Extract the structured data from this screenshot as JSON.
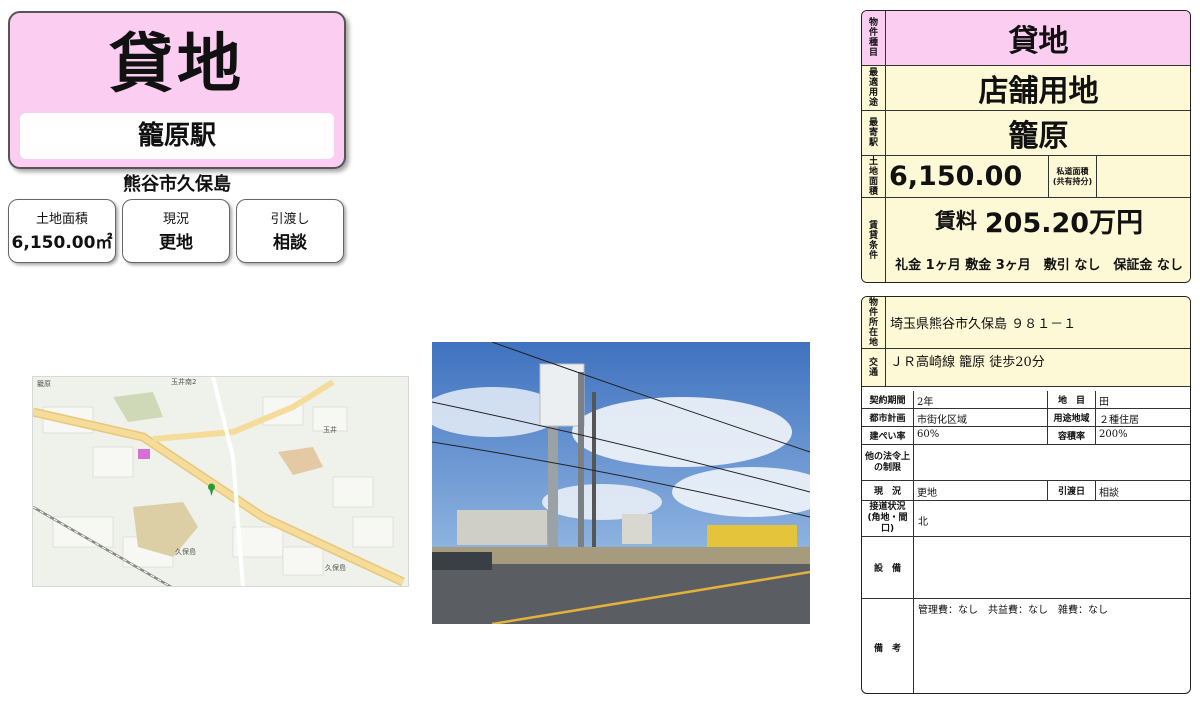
{
  "title": {
    "property_type": "貸地",
    "station": "籠原駅",
    "address": "熊谷市久保島"
  },
  "info_boxes": [
    {
      "label": "土地面積",
      "value": "6,150.00㎡"
    },
    {
      "label": "現況",
      "value": "更地"
    },
    {
      "label": "引渡し",
      "value": "相談"
    }
  ],
  "summary": {
    "type_label": "物件種目",
    "type_value": "貸地",
    "use_label": "最適用途",
    "use_value": "店舗用地",
    "station_label": "最寄駅",
    "station_value": "籠原",
    "area_label": "土地面積",
    "area_value": "6,150.00㎡",
    "private_road_label": "私道面積(共有持分)",
    "private_road_value": "",
    "lease_label": "賃貸条件",
    "rent_label": "賃料",
    "rent_value": "205.20万円",
    "conditions": "礼金 1ヶ月 敷金 3ヶ月　敷引 なし　保証金 なし"
  },
  "details": {
    "location_label": "物件所在地",
    "location_value": "埼玉県熊谷市久保島 ９８１－１",
    "transport_label": "交通",
    "transport_value": "ＪＲ高崎線 籠原 徒歩20分",
    "rows": [
      {
        "l1": "契約期間",
        "v1": "2年",
        "l2": "地　目",
        "v2": "田"
      },
      {
        "l1": "都市計画",
        "v1": "市街化区域",
        "l2": "用途地域",
        "v2": "２種住居"
      },
      {
        "l1": "建ぺい率",
        "v1": "60%",
        "l2": "容積率",
        "v2": "200%"
      }
    ],
    "other_law_label": "他の法令上の制限",
    "other_law_value": "",
    "status_label": "現　況",
    "status_value": "更地",
    "delivery_label": "引渡日",
    "delivery_value": "相談",
    "road_label": "接道状況(角地・間口)",
    "road_value": "北",
    "facility_label": "設　備",
    "facility_value": "",
    "remarks_label": "備　考",
    "remarks_value": "管理費：なし　共益費：なし　雑費：なし"
  },
  "map_labels": {
    "a": "久保島",
    "b": "久保島",
    "c": "玉井",
    "d": "玉井南2",
    "e": "籠原"
  }
}
